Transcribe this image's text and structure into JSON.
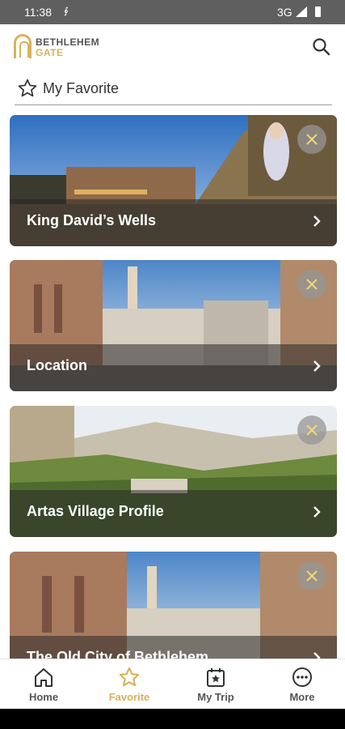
{
  "status": {
    "time": "11:38",
    "network": "3G"
  },
  "header": {
    "logo_line1": "BETHLEHEM",
    "logo_line2": "GATE"
  },
  "section": {
    "title": "My Favorite"
  },
  "cards": [
    {
      "label": "King David’s Wells"
    },
    {
      "label": "Location"
    },
    {
      "label": "Artas Village Profile"
    },
    {
      "label": "The Old City of Bethlehem"
    }
  ],
  "nav": {
    "items": [
      {
        "label": "Home"
      },
      {
        "label": "Favorite"
      },
      {
        "label": "My Trip"
      },
      {
        "label": "More"
      }
    ]
  },
  "colors": {
    "accent": "#d8b25a",
    "status_bar": "#5f5f5f",
    "overlay": "rgba(40,40,40,0.55)"
  }
}
